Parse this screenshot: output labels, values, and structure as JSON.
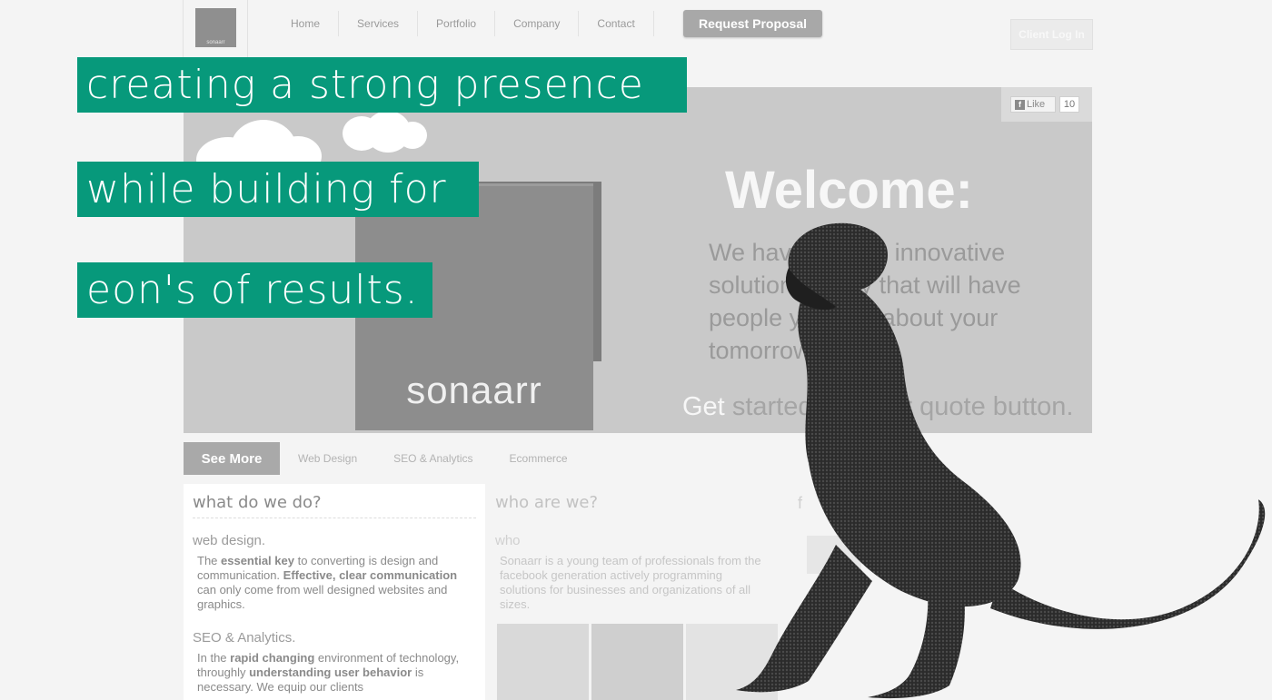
{
  "logo": {
    "text": "sonaarr"
  },
  "nav": {
    "items": [
      "Home",
      "Services",
      "Portfolio",
      "Company",
      "Contact"
    ]
  },
  "header": {
    "proposal_button": "Request Proposal",
    "client_login": "Client Log In"
  },
  "headline": {
    "lines": [
      "creating a strong presence",
      "while building for",
      "eon's of results."
    ],
    "color": "#07997b"
  },
  "hero": {
    "like_label": "Like",
    "like_count": "10",
    "sign_text": "sonaarr",
    "welcome_title": "Welcome:",
    "welcome_body": "We have catchy, innovative solutions today that will have people yapping about your tomorrow.",
    "cta_get": "Get",
    "cta_rest": "started with our quote button."
  },
  "tabs": {
    "active": "See More",
    "items": [
      "Web Design",
      "SEO & Analytics",
      "Ecommerce"
    ]
  },
  "what": {
    "heading": "what do we do?",
    "web_title": "web design.",
    "web_p1": "The ",
    "web_b1": "essential key",
    "web_p2": " to converting is design and communication. ",
    "web_b2": "Effective, clear communication",
    "web_p3": " can only come from well designed websites and graphics.",
    "seo_title": "SEO & Analytics.",
    "seo_p1": "In the ",
    "seo_b1": "rapid changing",
    "seo_p2": " environment of technology, throughly ",
    "seo_b2": "understanding user behavior",
    "seo_p3": " is necessary. We equip our clients"
  },
  "who": {
    "heading": "who are we?",
    "sub": "who",
    "body": "Sonaarr is a young team of professionals from the facebook generation actively programming solutions for businesses and organizations of all sizes."
  },
  "third_column": {
    "heading_initial": "f"
  }
}
